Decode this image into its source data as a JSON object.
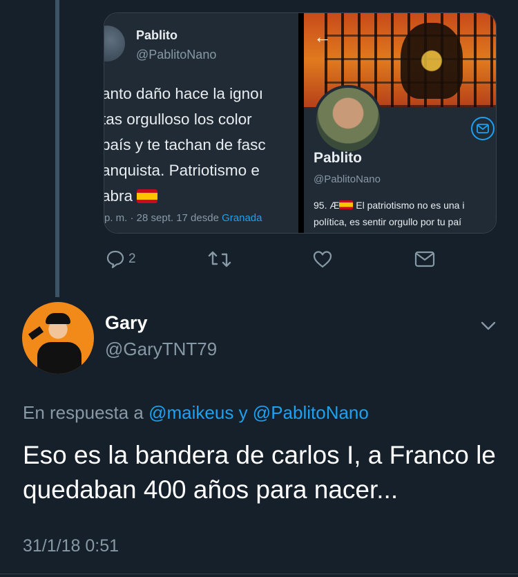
{
  "quoted_card": {
    "left": {
      "name": "Pablito",
      "handle": "@PablitoNano",
      "text_lines": [
        "anto daño hace la ignoı",
        "tas orgulloso los color",
        "país y te tachan de fasc",
        "anquista. Patriotismo e",
        "abra"
      ],
      "meta_prefix": "p. m. · 28 sept. 17 desde ",
      "meta_link": "Granada"
    },
    "right": {
      "name": "Pablito",
      "handle": "@PablitoNano",
      "bio_line1_prefix": "95. Æ",
      "bio_line1_suffix": "El patriotismo no es una i",
      "bio_line2": "política, es sentir orgullo por tu paí"
    }
  },
  "actions": {
    "reply_count": "2"
  },
  "tweet": {
    "name": "Gary",
    "handle": "@GaryTNT79",
    "reply_prefix": "En respuesta a ",
    "mention1": "@maikeus",
    "reply_join": " y ",
    "mention2": "@PablitoNano",
    "text": "Eso es la bandera de carlos I, a Franco le quedaban 400 años para nacer...",
    "timestamp": "31/1/18 0:51"
  },
  "colors": {
    "background": "#15202b",
    "accent": "#1da1f2",
    "secondary_text": "#8899a6"
  }
}
